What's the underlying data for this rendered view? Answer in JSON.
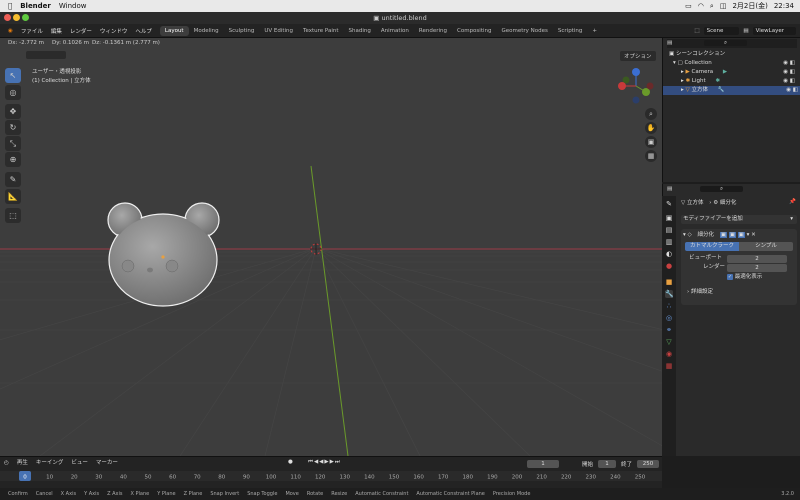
{
  "menubar": {
    "app": "Blender",
    "window": "Window",
    "date": "2月2日(金)",
    "time": "22:34"
  },
  "title": "untitled.blend",
  "topbar": {
    "menus": [
      "ファイル",
      "編集",
      "レンダー",
      "ウィンドウ",
      "ヘルプ"
    ],
    "workspaces": [
      "Layout",
      "Modeling",
      "Sculpting",
      "UV Editing",
      "Texture Paint",
      "Shading",
      "Animation",
      "Rendering",
      "Compositing",
      "Geometry Nodes",
      "Scripting"
    ],
    "add_tab": "+",
    "scene": "Scene",
    "view_layer": "ViewLayer"
  },
  "viewport": {
    "dx": "Dx: -2.772 m",
    "dy": "Dy: 0.1026 m",
    "dz": "Dz: -0.1361 m (2.777 m)",
    "view_name": "ユーザー・透視投影",
    "collection_info": "(1) Collection | 立方体",
    "options": "オプション",
    "gizmo": {
      "x": "X",
      "y": "Y",
      "z": "Z"
    },
    "colors": {
      "background": "#3d3d3d",
      "grid": "#4a4a4a",
      "x_axis": "#9a3a46",
      "y_axis": "#6a9a2a",
      "mesh": "#8c8c8c",
      "selection": "#f0f0f0"
    }
  },
  "outliner": {
    "scene_collection": "シーンコレクション",
    "items": [
      {
        "label": "Collection"
      },
      {
        "label": "Camera"
      },
      {
        "label": "Light"
      },
      {
        "label": "立方体"
      }
    ]
  },
  "properties": {
    "breadcrumb_obj": "立方体",
    "breadcrumb_mod": "細分化",
    "add_modifier": "モディファイアーを追加",
    "modifier_name": "細分化",
    "tab_catmull": "カトマルクラーク",
    "tab_simple": "シンプル",
    "viewport_label": "ビューポート",
    "viewport_value": "2",
    "render_label": "レンダー",
    "render_value": "2",
    "optimal_display": "最適化表示",
    "advanced": "詳細設定"
  },
  "timeline": {
    "menus": [
      "再生",
      "キーイング",
      "ビュー",
      "マーカー"
    ],
    "current_frame": "1",
    "start_label": "開始",
    "start": "1",
    "end_label": "終了",
    "end": "250",
    "ticks": [
      "0",
      "10",
      "20",
      "30",
      "40",
      "50",
      "60",
      "70",
      "80",
      "90",
      "100",
      "110",
      "120",
      "130",
      "140",
      "150",
      "160",
      "170",
      "180",
      "190",
      "200",
      "210",
      "220",
      "230",
      "240",
      "250"
    ]
  },
  "statusbar": {
    "items": [
      "Confirm",
      "Cancel",
      "X Axis",
      "Y Axis",
      "Z Axis",
      "X Plane",
      "Y Plane",
      "Z Plane",
      "Snap Invert",
      "Snap Toggle",
      "Move",
      "Rotate",
      "Resize",
      "Automatic Constraint",
      "Automatic Constraint Plane",
      "Precision Mode"
    ],
    "version": "3.2.0"
  }
}
